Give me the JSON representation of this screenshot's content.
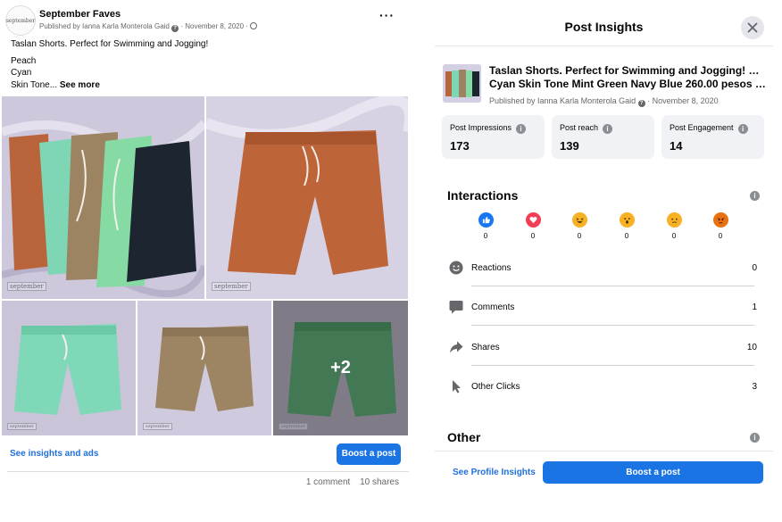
{
  "post": {
    "avatar_text": "september",
    "page_name": "September Faves",
    "published_by": "Published by Ianna Karla Monterola Gaid",
    "date": "November 8, 2020",
    "caption_line1": "Taslan Shorts. Perfect for Swimming and Jogging!",
    "caption_line2": "Peach",
    "caption_line3": "Cyan",
    "caption_line4": "Skin Tone...",
    "see_more": "See more",
    "watermark": "september",
    "more_photos": "+2",
    "insights_link": "See insights and ads",
    "boost_label": "Boost a post",
    "comments": "1 comment",
    "shares": "10 shares"
  },
  "insights": {
    "title": "Post Insights",
    "post_text_line1": "Taslan Shorts. Perfect for Swimming and Jogging! Peach",
    "post_text_line2": "Cyan Skin Tone Mint Green Navy Blue 260.00 pesos onl...",
    "published_by": "Published by Ianna Karla Monterola Gaid",
    "date": "November 8, 2020",
    "metrics": [
      {
        "label": "Post Impressions",
        "value": "173"
      },
      {
        "label": "Post reach",
        "value": "139"
      },
      {
        "label": "Post Engagement",
        "value": "14"
      }
    ],
    "interactions_title": "Interactions",
    "reactions": [
      {
        "name": "like",
        "count": "0",
        "color": "#1877f2"
      },
      {
        "name": "love",
        "count": "0",
        "color": "#f33e58"
      },
      {
        "name": "haha",
        "count": "0",
        "color": "#f7b125"
      },
      {
        "name": "wow",
        "count": "0",
        "color": "#f7b125"
      },
      {
        "name": "sad",
        "count": "0",
        "color": "#f7b125"
      },
      {
        "name": "angry",
        "count": "0",
        "color": "#e9710f"
      }
    ],
    "rows": [
      {
        "label": "Reactions",
        "value": "0",
        "icon": "smiley-icon"
      },
      {
        "label": "Comments",
        "value": "1",
        "icon": "comment-icon"
      },
      {
        "label": "Shares",
        "value": "10",
        "icon": "share-icon"
      },
      {
        "label": "Other Clicks",
        "value": "3",
        "icon": "cursor-icon"
      }
    ],
    "other_title": "Other",
    "profile_insights_link": "See Profile Insights",
    "boost_label": "Boost a post"
  },
  "colors": {
    "brand_blue": "#1b74e4",
    "link_blue": "#216fdb",
    "peach": "#b9643a",
    "mint": "#7fd6b5",
    "khaki": "#9c8462",
    "green": "#66b982",
    "navy": "#1d2530"
  }
}
